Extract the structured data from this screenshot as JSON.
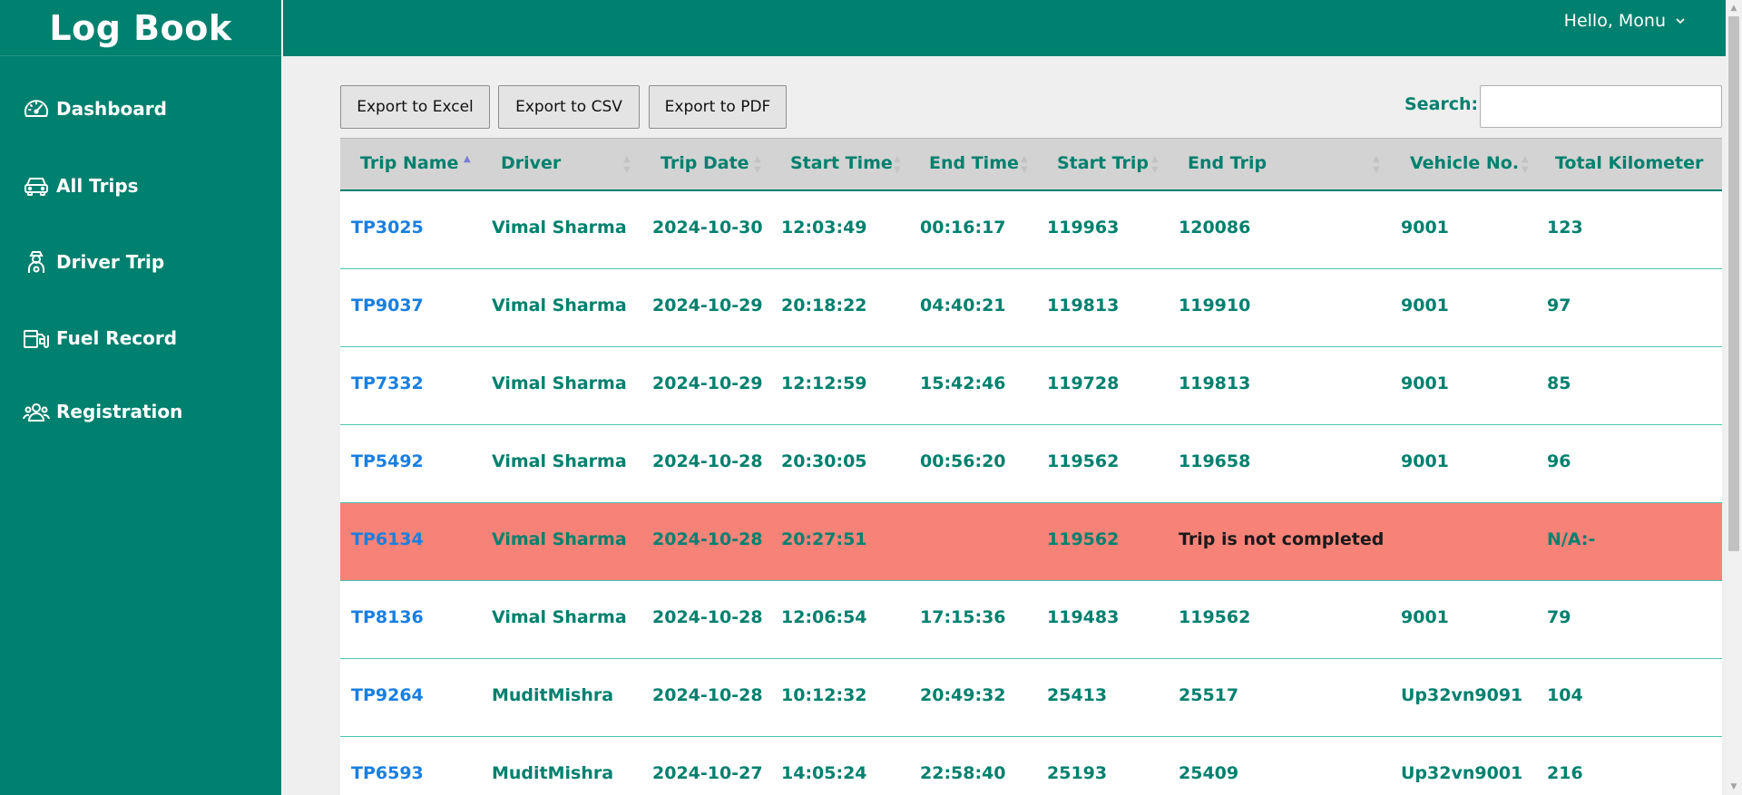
{
  "app": {
    "brand": "Log Book"
  },
  "sidebar": {
    "items": [
      {
        "label": "Dashboard",
        "icon": "speedometer-icon"
      },
      {
        "label": "All Trips",
        "icon": "car-icon"
      },
      {
        "label": "Driver Trip",
        "icon": "driver-icon"
      },
      {
        "label": "Fuel Record",
        "icon": "fuel-pump-icon"
      },
      {
        "label": "Registration",
        "icon": "users-icon"
      }
    ]
  },
  "header": {
    "greeting": "Hello, Monu",
    "dropdown_icon": "chevron-down-icon"
  },
  "toolbar": {
    "export_excel": "Export to Excel",
    "export_csv": "Export to CSV",
    "export_pdf": "Export to PDF",
    "search_label": "Search:",
    "search_value": ""
  },
  "table": {
    "columns": [
      "Trip Name",
      "Driver",
      "Trip Date",
      "Start Time",
      "End Time",
      "Start Trip",
      "End Trip",
      "Vehicle No.",
      "Total Kilometer"
    ],
    "sorted_column": "Trip Name",
    "sort_direction": "ascending",
    "rows": [
      {
        "trip": "TP3025",
        "driver": "Vimal Sharma",
        "date": "2024-10-30",
        "start_time": "12:03:49",
        "end_time": "00:16:17",
        "start_trip": "119963",
        "end_trip": "120086",
        "vehicle": "9001",
        "km": "123"
      },
      {
        "trip": "TP9037",
        "driver": "Vimal Sharma",
        "date": "2024-10-29",
        "start_time": "20:18:22",
        "end_time": "04:40:21",
        "start_trip": "119813",
        "end_trip": "119910",
        "vehicle": "9001",
        "km": "97"
      },
      {
        "trip": "TP7332",
        "driver": "Vimal Sharma",
        "date": "2024-10-29",
        "start_time": "12:12:59",
        "end_time": "15:42:46",
        "start_trip": "119728",
        "end_trip": "119813",
        "vehicle": "9001",
        "km": "85"
      },
      {
        "trip": "TP5492",
        "driver": "Vimal Sharma",
        "date": "2024-10-28",
        "start_time": "20:30:05",
        "end_time": "00:56:20",
        "start_trip": "119562",
        "end_trip": "119658",
        "vehicle": "9001",
        "km": "96"
      },
      {
        "trip": "TP6134",
        "driver": "Vimal Sharma",
        "date": "2024-10-28",
        "start_time": "20:27:51",
        "end_time": "",
        "start_trip": "119562",
        "end_trip": "Trip is not completed",
        "vehicle": "",
        "km": "N/A:-",
        "incomplete": true
      },
      {
        "trip": "TP8136",
        "driver": "Vimal Sharma",
        "date": "2024-10-28",
        "start_time": "12:06:54",
        "end_time": "17:15:36",
        "start_trip": "119483",
        "end_trip": "119562",
        "vehicle": "9001",
        "km": "79"
      },
      {
        "trip": "TP9264",
        "driver": "MuditMishra",
        "date": "2024-10-28",
        "start_time": "10:12:32",
        "end_time": "20:49:32",
        "start_trip": "25413",
        "end_trip": "25517",
        "vehicle": "Up32vn9091",
        "km": "104"
      },
      {
        "trip": "TP6593",
        "driver": "MuditMishra",
        "date": "2024-10-27",
        "start_time": "14:05:24",
        "end_time": "22:58:40",
        "start_trip": "25193",
        "end_trip": "25409",
        "vehicle": "Up32vn9001",
        "km": "216"
      }
    ]
  }
}
